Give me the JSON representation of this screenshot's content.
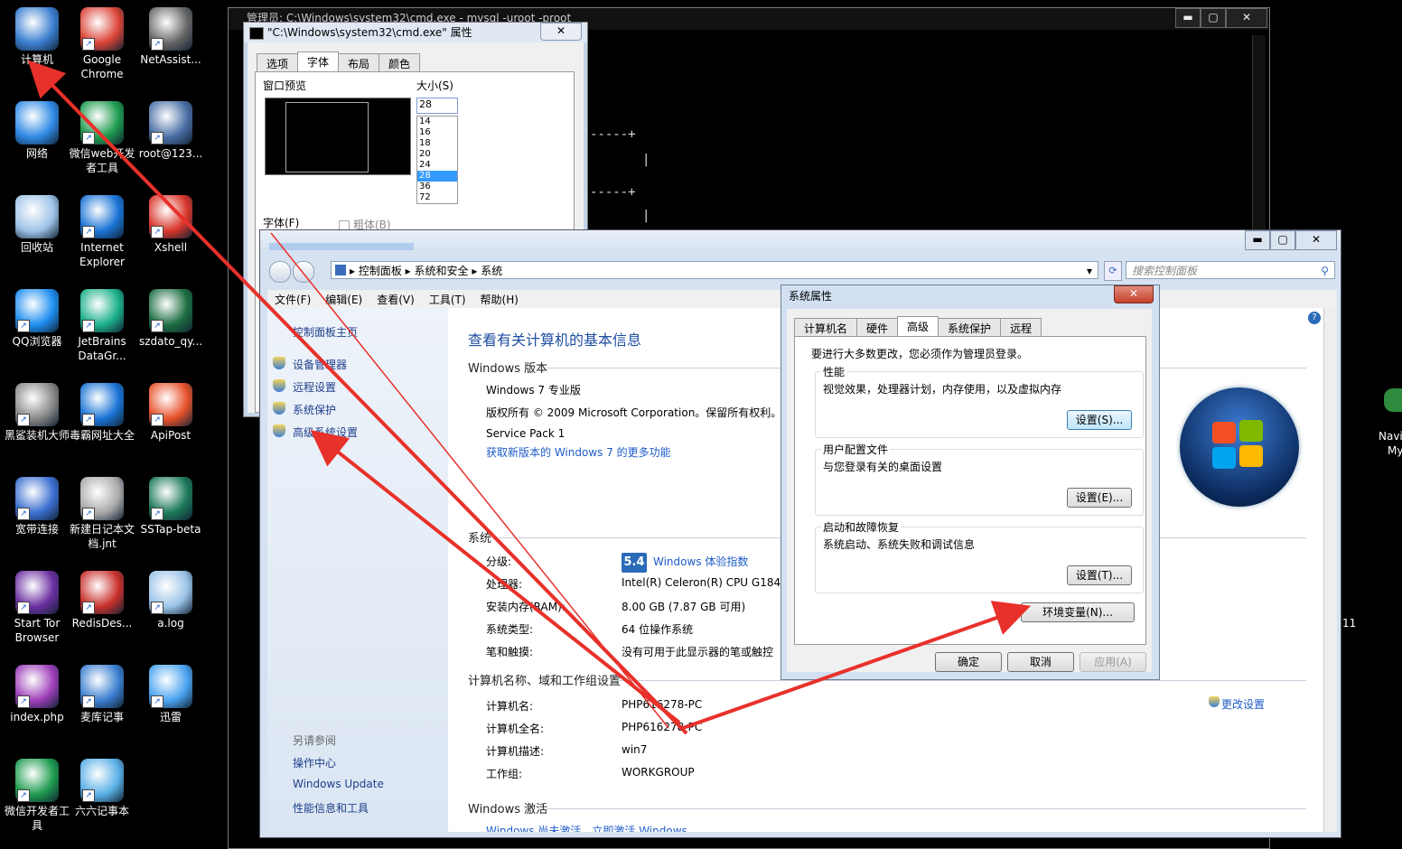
{
  "desktop": {
    "icons": [
      {
        "label": "计算机",
        "icon": "computer-icon"
      },
      {
        "label": "Google Chrome",
        "icon": "chrome-icon"
      },
      {
        "label": "NetAssist...",
        "icon": "netassist-icon"
      },
      {
        "label": "网络",
        "icon": "network-icon"
      },
      {
        "label": "微信web开发者工具",
        "icon": "wechat-devtools-icon"
      },
      {
        "label": "root@123...",
        "icon": "ssh-terminal-icon"
      },
      {
        "label": "回收站",
        "icon": "recycle-bin-icon"
      },
      {
        "label": "Internet Explorer",
        "icon": "ie-icon"
      },
      {
        "label": "Xshell",
        "icon": "xshell-icon"
      },
      {
        "label": "QQ浏览器",
        "icon": "qq-browser-icon"
      },
      {
        "label": "JetBrains DataGr...",
        "icon": "datagrip-icon"
      },
      {
        "label": "szdato_qy...",
        "icon": "excel-file-icon"
      },
      {
        "label": "黑鲨装机大师",
        "icon": "blackshark-icon"
      },
      {
        "label": "毒霸网址大全",
        "icon": "ie-icon"
      },
      {
        "label": "ApiPost",
        "icon": "apipost-icon"
      },
      {
        "label": "宽带连接",
        "icon": "broadband-icon"
      },
      {
        "label": "新建日记本文档.jnt",
        "icon": "journal-file-icon"
      },
      {
        "label": "SSTap-beta",
        "icon": "sstap-icon"
      },
      {
        "label": "Start Tor Browser",
        "icon": "tor-icon"
      },
      {
        "label": "RedisDes...",
        "icon": "redis-icon"
      },
      {
        "label": "a.log",
        "icon": "log-file-icon"
      },
      {
        "label": "index.php",
        "icon": "phpstorm-icon"
      },
      {
        "label": "麦库记事",
        "icon": "notes-icon"
      },
      {
        "label": "迅雷",
        "icon": "xunlei-icon"
      },
      {
        "label": "微信开发者工具",
        "icon": "wechat-devtools-icon"
      },
      {
        "label": "六六记事本",
        "icon": "notebook-icon"
      }
    ],
    "partial_right": [
      "Navi",
      "My",
      "11"
    ]
  },
  "console": {
    "title": "管理员: C:\\Windows\\system32\\cmd.exe - mysql -uroot -proot",
    "min": "▬",
    "max": "▢",
    "close": "✕"
  },
  "cmd_properties": {
    "title": "\"C:\\Windows\\system32\\cmd.exe\" 属性",
    "close": "✕",
    "tabs": [
      "选项",
      "字体",
      "布局",
      "颜色"
    ],
    "active_tab": "字体",
    "preview_label": "窗口预览",
    "size_label": "大小(S)",
    "size_value": "28",
    "size_options": [
      "14",
      "16",
      "18",
      "20",
      "24",
      "28",
      "36",
      "72"
    ],
    "size_selected": "28",
    "font_label": "字体(F)",
    "bold_label": "粗体(B)"
  },
  "control_panel": {
    "breadcrumb": [
      "控制面板",
      "系统和安全",
      "系统"
    ],
    "search_placeholder": "搜索控制面板",
    "menu": [
      "文件(F)",
      "编辑(E)",
      "查看(V)",
      "工具(T)",
      "帮助(H)"
    ],
    "left": {
      "home": "控制面板主页",
      "links": [
        "设备管理器",
        "远程设置",
        "系统保护",
        "高级系统设置"
      ],
      "see_also_title": "另请参阅",
      "see_also": [
        "操作中心",
        "Windows Update",
        "性能信息和工具"
      ]
    },
    "main": {
      "heading": "查看有关计算机的基本信息",
      "win_edition_title": "Windows 版本",
      "edition": "Windows 7 专业版",
      "copyright": "版权所有 © 2009 Microsoft Corporation。保留所有权利。",
      "service_pack": "Service Pack 1",
      "more_features": "获取新版本的 Windows 7 的更多功能",
      "system_title": "系统",
      "rows": [
        {
          "k": "分级:",
          "v": "Windows 体验指数"
        },
        {
          "k": "处理器:",
          "v": "Intel(R) Celeron(R) CPU G1840"
        },
        {
          "k": "安装内存(RAM):",
          "v": "8.00 GB (7.87 GB 可用)"
        },
        {
          "k": "系统类型:",
          "v": "64 位操作系统"
        },
        {
          "k": "笔和触摸:",
          "v": "没有可用于此显示器的笔或触控"
        }
      ],
      "rating": "5.4",
      "computer_title": "计算机名称、域和工作组设置",
      "comp_rows": [
        {
          "k": "计算机名:",
          "v": "PHP616278-PC"
        },
        {
          "k": "计算机全名:",
          "v": "PHP616278-PC"
        },
        {
          "k": "计算机描述:",
          "v": "win7"
        },
        {
          "k": "工作组:",
          "v": "WORKGROUP"
        }
      ],
      "change_settings": "更改设置",
      "activation_title": "Windows 激活",
      "activation_partial": "Windows 尚未激活。立即激活 Windows"
    },
    "min": "▬",
    "max": "▢",
    "close": "✕",
    "help": "?"
  },
  "system_properties": {
    "title": "系统属性",
    "close": "✕",
    "tabs": [
      "计算机名",
      "硬件",
      "高级",
      "系统保护",
      "远程"
    ],
    "active_tab": "高级",
    "admin_note": "要进行大多数更改，您必须作为管理员登录。",
    "perf_title": "性能",
    "perf_desc": "视觉效果，处理器计划，内存使用，以及虚拟内存",
    "perf_btn": "设置(S)...",
    "profile_title": "用户配置文件",
    "profile_desc": "与您登录有关的桌面设置",
    "profile_btn": "设置(E)...",
    "startup_title": "启动和故障恢复",
    "startup_desc": "系统启动、系统失败和调试信息",
    "startup_btn": "设置(T)...",
    "env_btn": "环境变量(N)...",
    "ok": "确定",
    "cancel": "取消",
    "apply": "应用(A)"
  },
  "colors": {
    "annotation": "#e8312a",
    "link": "#1e5cc8",
    "heading": "#1e4ea0"
  }
}
